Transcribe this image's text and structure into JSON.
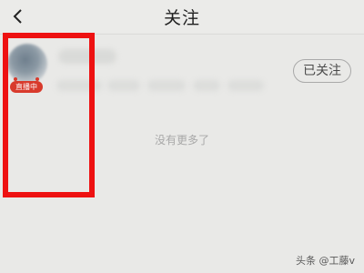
{
  "header": {
    "title": "关注",
    "back_icon": "chevron-left-icon"
  },
  "list": {
    "items": [
      {
        "badge": "直播中",
        "status_button": "已关注"
      }
    ],
    "end_text": "没有更多了"
  },
  "annotation": {
    "color": "#ee1111"
  },
  "watermark": "头条 @工藤v"
}
